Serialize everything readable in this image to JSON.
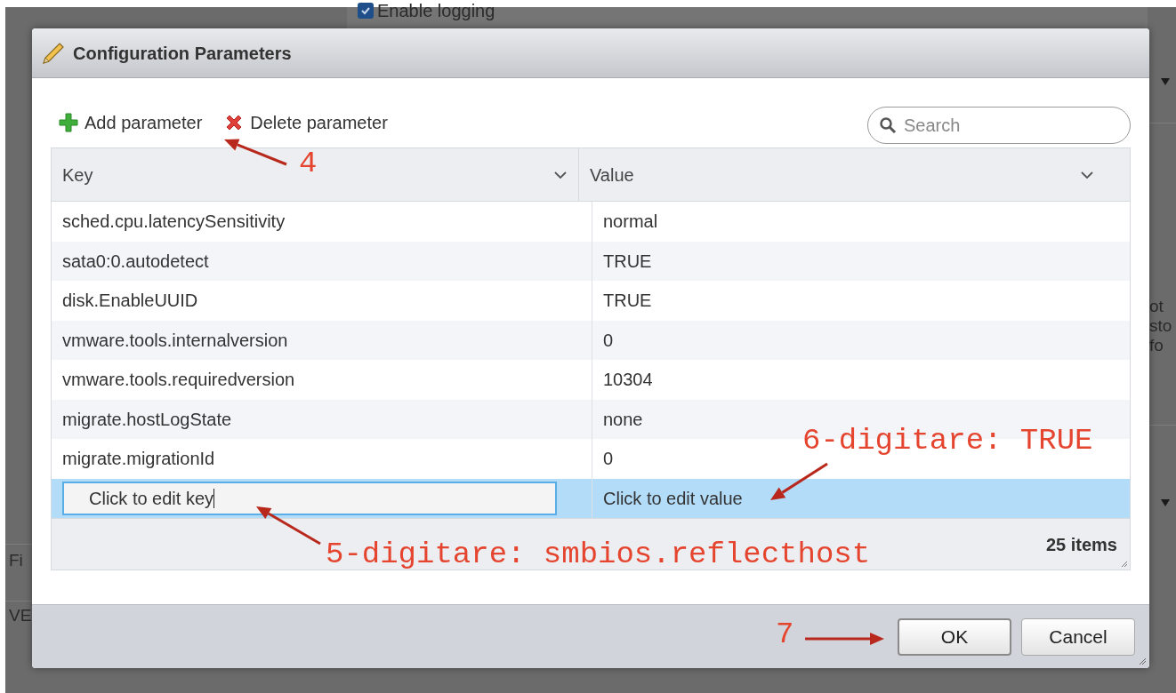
{
  "background": {
    "checkbox": {
      "label": "Enable logging",
      "checked": true
    },
    "right_texts": [
      "ot",
      "sto",
      "fo"
    ],
    "left_texts": [
      "Fi",
      "VE"
    ]
  },
  "dialog": {
    "title": "Configuration Parameters",
    "toolbar": [
      {
        "kind": "add",
        "label": "Add parameter"
      },
      {
        "kind": "delete",
        "label": "Delete parameter"
      }
    ],
    "search": {
      "placeholder": "Search"
    },
    "columns": [
      "Key",
      "Value"
    ],
    "rows": [
      {
        "key": "sched.cpu.latencySensitivity",
        "value": "normal",
        "selected": false
      },
      {
        "key": "sata0:0.autodetect",
        "value": "TRUE",
        "selected": false
      },
      {
        "key": "disk.EnableUUID",
        "value": "TRUE",
        "selected": false
      },
      {
        "key": "vmware.tools.internalversion",
        "value": "0",
        "selected": false
      },
      {
        "key": "vmware.tools.requiredversion",
        "value": "10304",
        "selected": false
      },
      {
        "key": "migrate.hostLogState",
        "value": "none",
        "selected": false
      },
      {
        "key": "migrate.migrationId",
        "value": "0",
        "selected": false
      },
      {
        "key": "Click to edit key",
        "value": "Click to edit value",
        "selected": true,
        "editing": true
      }
    ],
    "item_count": "25 items",
    "buttons": [
      {
        "label": "OK",
        "default": true
      },
      {
        "label": "Cancel",
        "default": false
      }
    ]
  },
  "annotations": [
    {
      "text": "4"
    },
    {
      "text": "5-digitare: smbios.reflecthost"
    },
    {
      "text": "6-digitare: TRUE"
    },
    {
      "text": "7"
    }
  ]
}
